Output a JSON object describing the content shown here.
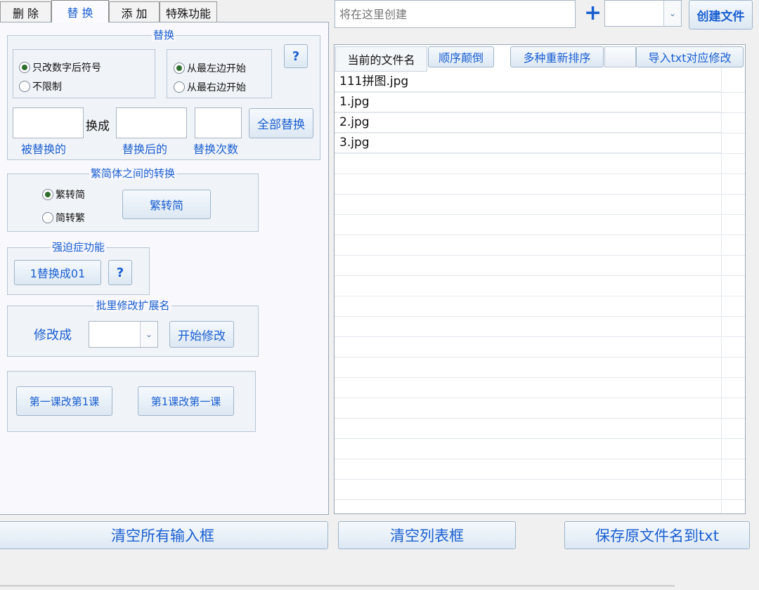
{
  "tabs": [
    {
      "label": "删 除"
    },
    {
      "label": "替 换"
    },
    {
      "label": "添 加"
    },
    {
      "label": "特殊功能"
    }
  ],
  "replace_group": {
    "title": "替换",
    "radio_scope": {
      "opt1": "只改数字后符号",
      "opt2": "不限制",
      "selected": "只改数字后符号"
    },
    "radio_dir": {
      "opt1": "从最左边开始",
      "opt2": "从最右边开始",
      "selected": "从最左边开始"
    },
    "help": "?",
    "to_label": "换成",
    "replace_all": "全部替换",
    "labels": {
      "old": "被替换的",
      "new": "替换后的",
      "count": "替换次数"
    }
  },
  "trad_simp_group": {
    "title": "繁简体之间的转换",
    "opt1": "繁转简",
    "opt2": "简转繁",
    "selected": "繁转简",
    "button": "繁转简"
  },
  "ocd_group": {
    "title": "强迫症功能",
    "button": "1替换成01",
    "help": "?"
  },
  "ext_group": {
    "title": "批里修改扩展名",
    "label": "修改成",
    "button": "开始修改"
  },
  "lesson_group": {
    "btn1": "第一课改第1课",
    "btn2": "第1课改第一课"
  },
  "create_bar": {
    "placeholder": "将在这里创建",
    "plus": "+",
    "create_button": "创建文件"
  },
  "file_list": {
    "header": "当前的文件名",
    "reverse_button": "顺序颠倒",
    "sort_button": "多种重新排序",
    "import_button": "导入txt对应修改",
    "files": [
      "111拼图.jpg",
      "1.jpg",
      "2.jpg",
      "3.jpg"
    ]
  },
  "bottom": {
    "clear_inputs": "清空所有输入框",
    "clear_list": "清空列表框",
    "save_names": "保存原文件名到txt"
  }
}
